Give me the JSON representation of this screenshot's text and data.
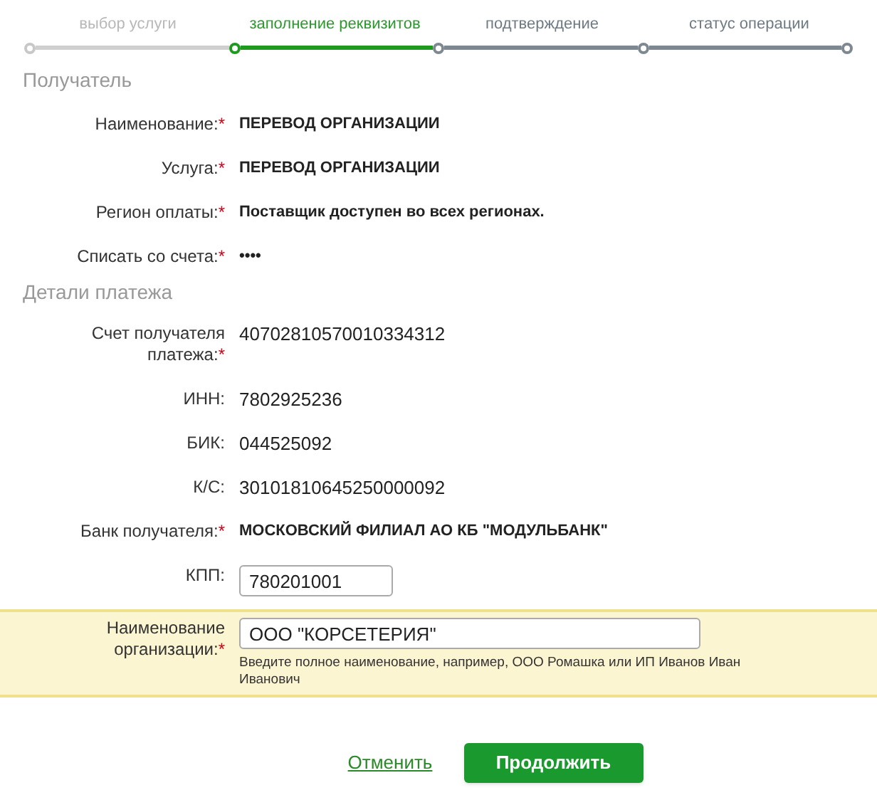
{
  "steps": [
    {
      "label": "выбор услуги",
      "kind": "done"
    },
    {
      "label": "заполнение реквизитов",
      "kind": "current"
    },
    {
      "label": "подтверждение",
      "kind": "pending"
    },
    {
      "label": "статус операции",
      "kind": "pending"
    }
  ],
  "sections": [
    {
      "title": "Получатель",
      "rows": [
        {
          "label": "Наименование:",
          "mark": "*",
          "kind": "bold",
          "value": "ПЕРЕВОД ОРГАНИЗАЦИИ"
        },
        {
          "label": "Услуга:",
          "mark": "*",
          "kind": "bold",
          "value": "ПЕРЕВОД ОРГАНИЗАЦИИ"
        },
        {
          "label": "Регион оплаты:",
          "mark": "*",
          "kind": "bold",
          "value": "Поставщик доступен во всех регионах."
        },
        {
          "label": "Списать со счета:",
          "mark": "*",
          "kind": "bold",
          "value": "••••"
        }
      ]
    },
    {
      "title": "Детали платежа",
      "rows": [
        {
          "label": "Счет получателя платежа:",
          "mark": "*",
          "kind": "plain",
          "value": "40702810570010334312"
        },
        {
          "label": "ИНН:",
          "kind": "plain",
          "value": "7802925236"
        },
        {
          "label": "БИК:",
          "kind": "plain",
          "value": "044525092"
        },
        {
          "label": "К/С:",
          "kind": "plain",
          "value": "30101810645250000092"
        },
        {
          "label": "Банк получателя:",
          "mark": "*",
          "kind": "bold",
          "value": "МОСКОВСКИЙ ФИЛИАЛ АО КБ \"МОДУЛЬБАНК\""
        },
        {
          "label": "КПП:",
          "kind": "input",
          "value": "780201001",
          "highlighted": false
        },
        {
          "label": "Наименование организации:",
          "mark": "*",
          "kind": "input",
          "value": "ООО \"КОРСЕТЕРИЯ\"",
          "highlighted": true,
          "hint": "Введите полное наименование, например, ООО Ромашка или ИП Иванов Иван Иванович"
        }
      ]
    }
  ],
  "actions": {
    "cancel": "Отменить",
    "continue": "Продолжить"
  }
}
